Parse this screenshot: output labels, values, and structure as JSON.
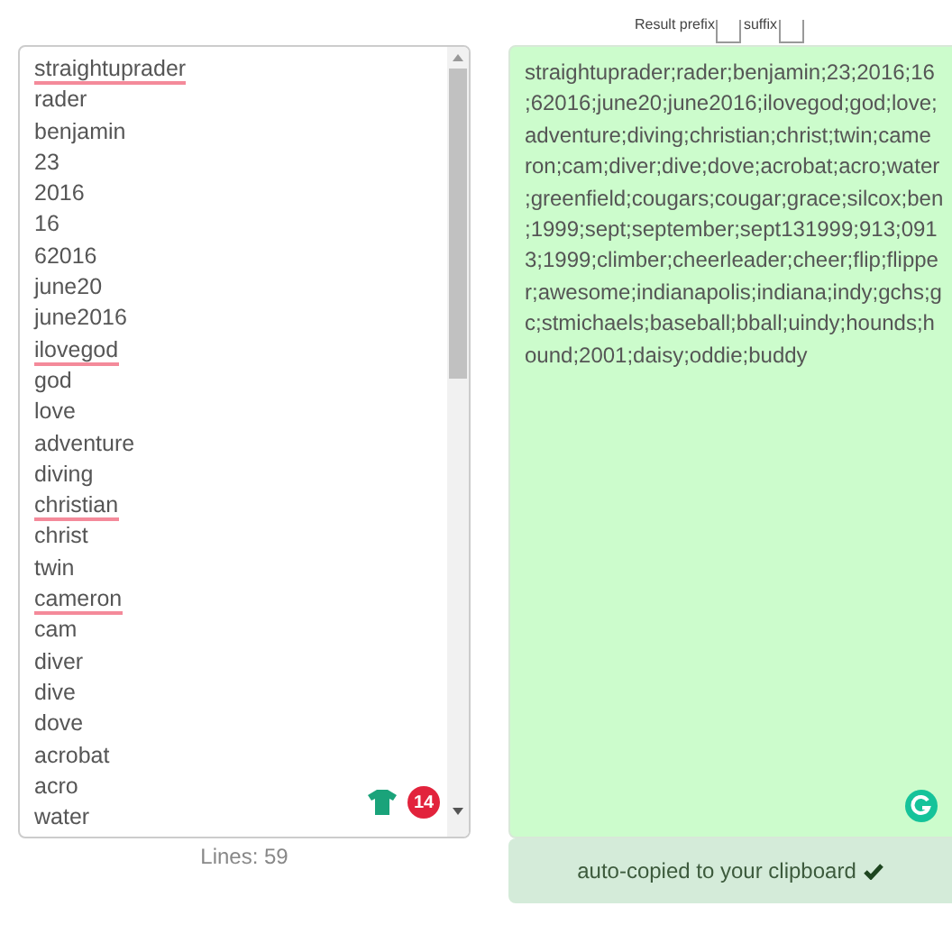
{
  "input_lines": [
    {
      "text": "straightuprader",
      "misspelled": true
    },
    {
      "text": "rader",
      "misspelled": false
    },
    {
      "text": "benjamin",
      "misspelled": false
    },
    {
      "text": "23",
      "misspelled": false
    },
    {
      "text": "2016",
      "misspelled": false
    },
    {
      "text": "16",
      "misspelled": false
    },
    {
      "text": "62016",
      "misspelled": false
    },
    {
      "text": "june20",
      "misspelled": false
    },
    {
      "text": "june2016",
      "misspelled": false
    },
    {
      "text": "ilovegod",
      "misspelled": true
    },
    {
      "text": "god",
      "misspelled": false
    },
    {
      "text": "love",
      "misspelled": false
    },
    {
      "text": "adventure",
      "misspelled": false
    },
    {
      "text": "diving",
      "misspelled": false
    },
    {
      "text": "christian",
      "misspelled": true
    },
    {
      "text": "christ",
      "misspelled": false
    },
    {
      "text": "twin",
      "misspelled": false
    },
    {
      "text": "cameron",
      "misspelled": true
    },
    {
      "text": "cam",
      "misspelled": false
    },
    {
      "text": "diver",
      "misspelled": false
    },
    {
      "text": "dive",
      "misspelled": false
    },
    {
      "text": "dove",
      "misspelled": false
    },
    {
      "text": "acrobat",
      "misspelled": false
    },
    {
      "text": "acro",
      "misspelled": false
    },
    {
      "text": "water",
      "misspelled": false
    }
  ],
  "badge_count": "14",
  "lines_count": "Lines: 59",
  "prefix_label": "Result prefix",
  "suffix_label": "suffix",
  "result_lines": [
    "straightuprader;rader;benjamin;23;2016;16",
    ";62016;june20;june2016;ilovegod;god;love;",
    "adventure;diving;christian;christ;twin;came",
    "ron;cam;diver;dive;dove;acrobat;acro;water",
    ";greenfield;cougars;cougar;grace;silcox;ben",
    ";1999;sept;september;sept131999;913;091",
    "3;1999;climber;cheerleader;cheer;flip;flippe",
    "r;awesome;indianapolis;indiana;indy;gchs;g",
    "c;stmichaels;baseball;bball;uindy;hounds;h",
    "ound;2001;daisy;oddie;buddy"
  ],
  "copied_message": "auto-copied to your clipboard"
}
